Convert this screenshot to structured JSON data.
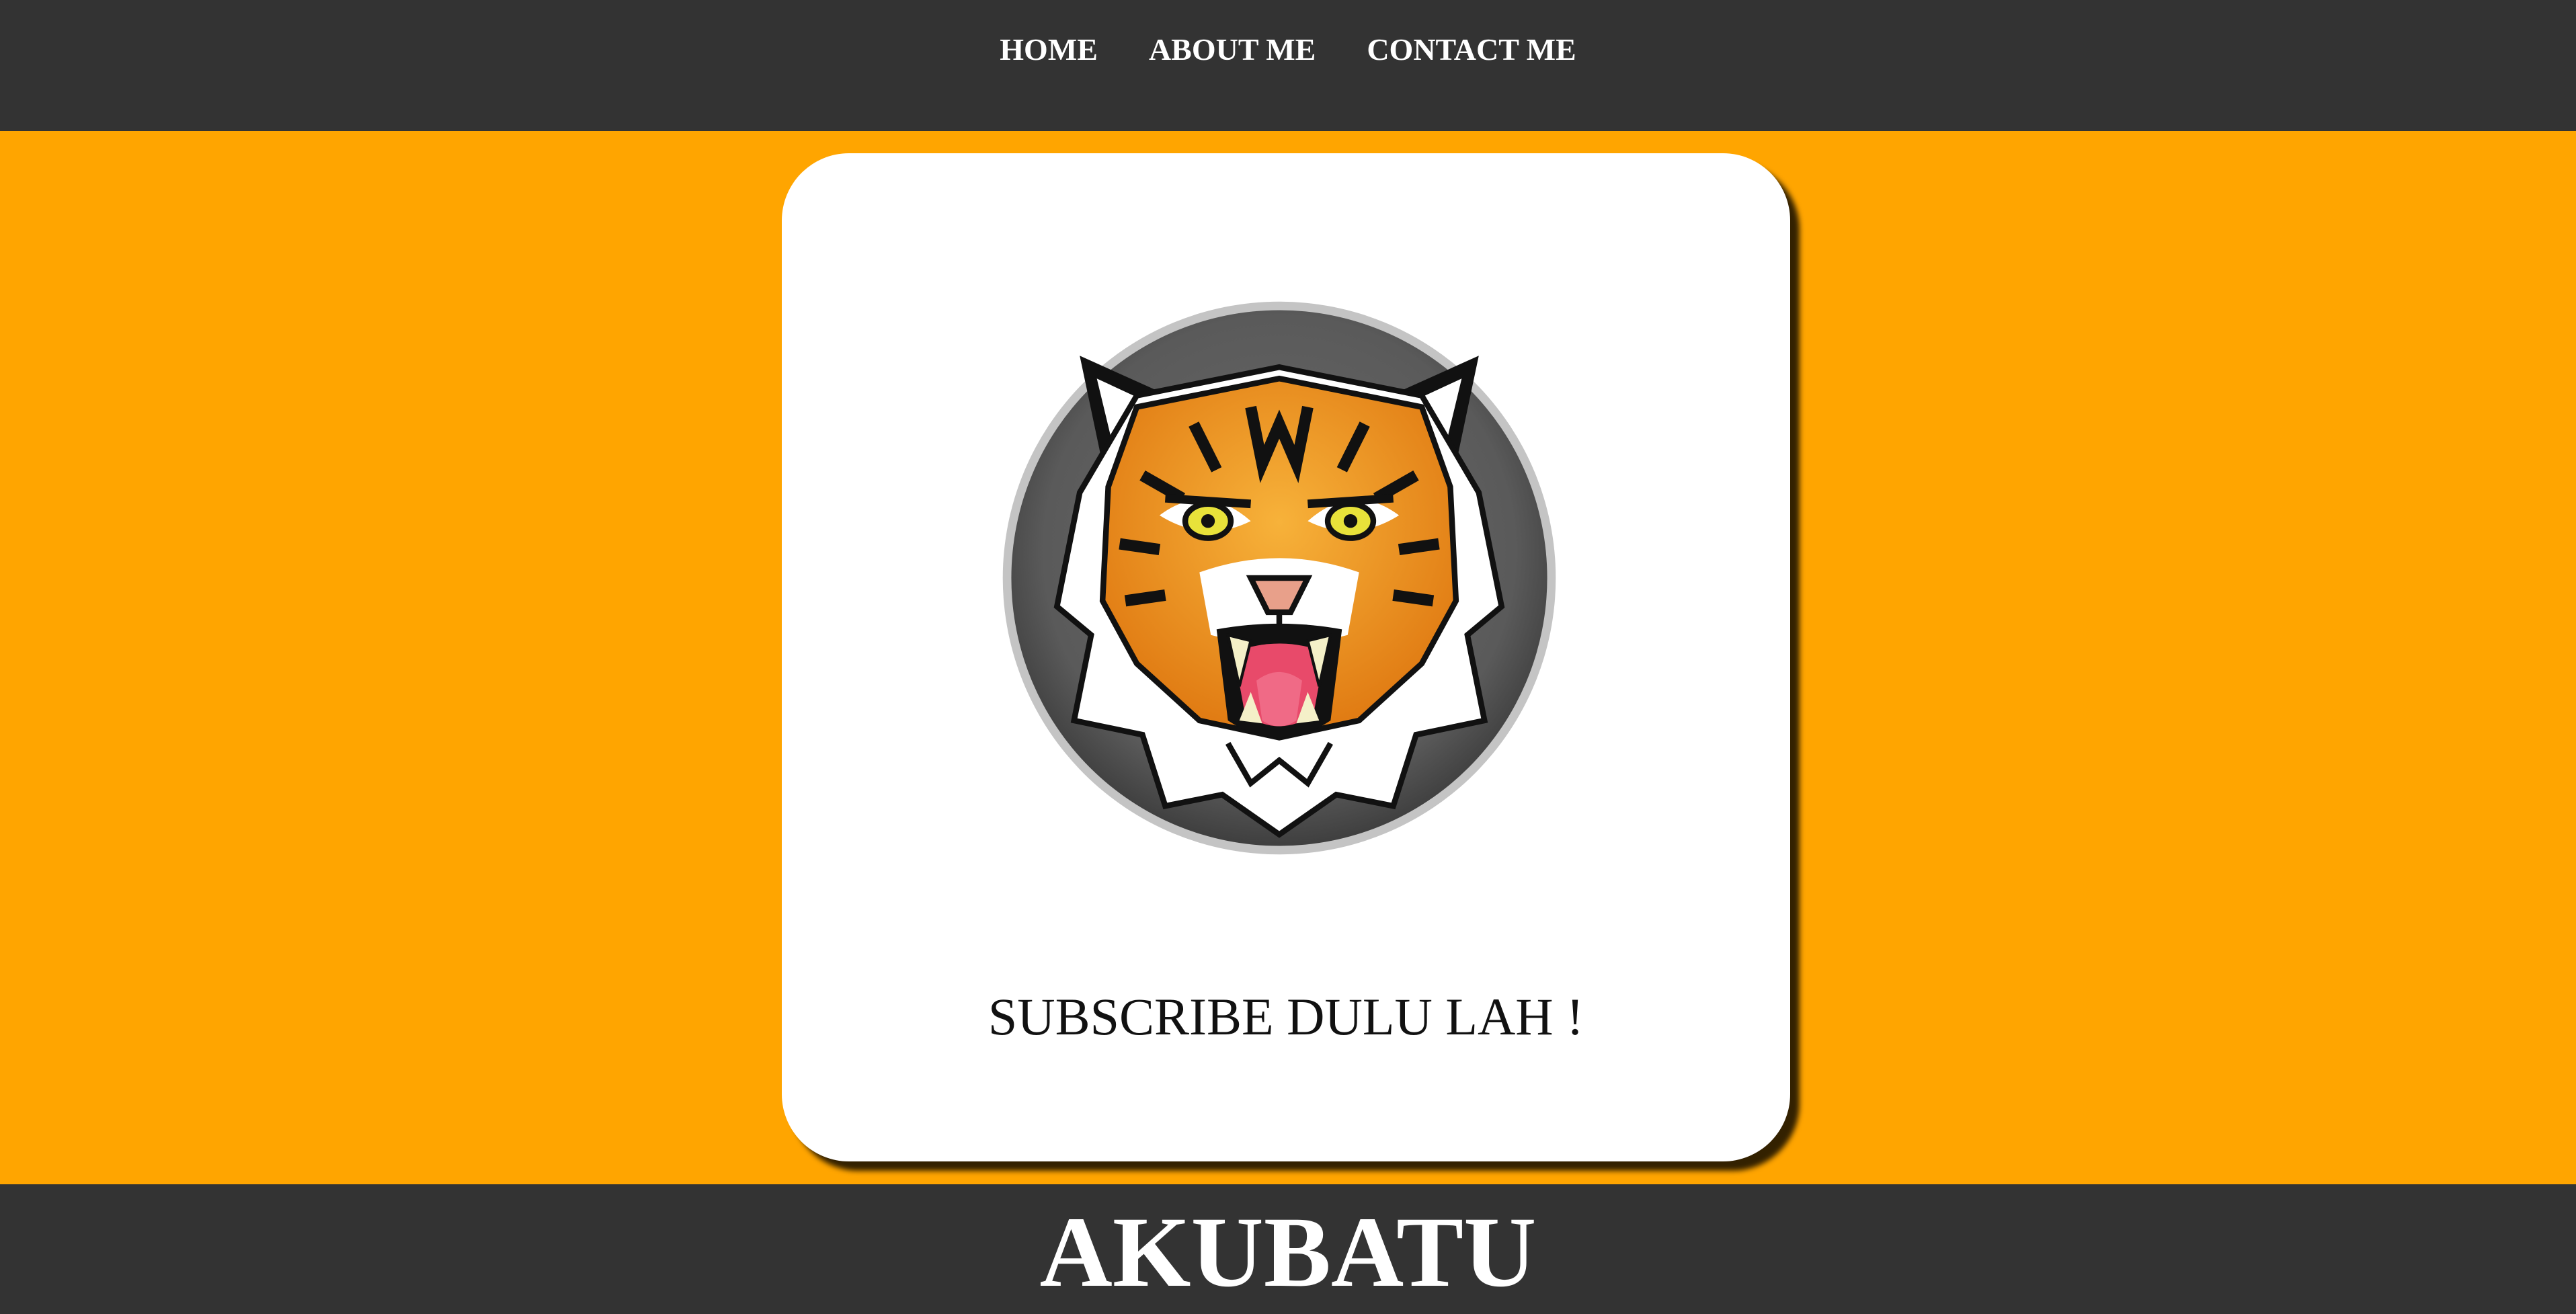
{
  "nav": {
    "items": [
      {
        "label": "HOME"
      },
      {
        "label": "ABOUT ME"
      },
      {
        "label": "CONTACT ME"
      }
    ]
  },
  "card": {
    "logo_icon": "tiger-head-icon",
    "subscribe_text": "SUBSCRIBE DULU LAH !"
  },
  "footer": {
    "title": "AKUBATU"
  },
  "colors": {
    "page_background": "#ffa500",
    "bar_background": "#333333",
    "card_background": "#ffffff",
    "text_light": "#ffffff",
    "text_dark": "#111111"
  }
}
